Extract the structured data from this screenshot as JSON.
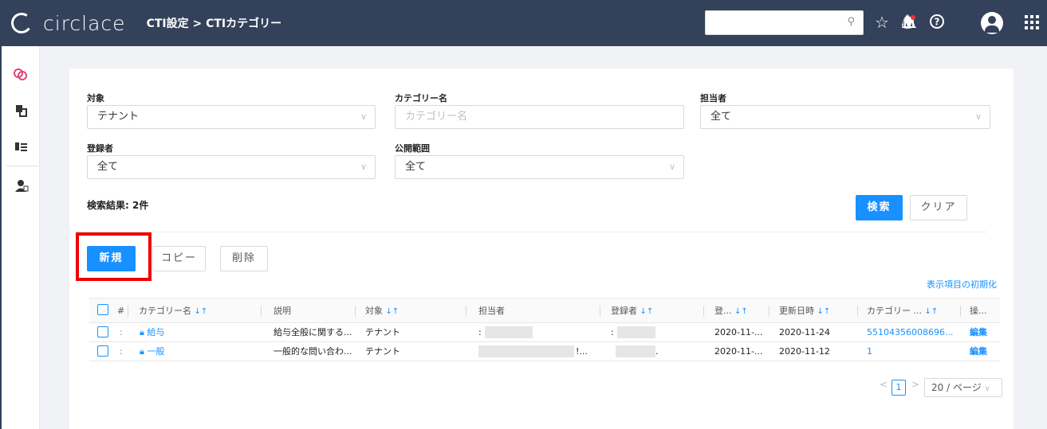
{
  "header": {
    "logo_text": "circlace",
    "breadcrumb": "CTI設定 > CTIカテゴリー",
    "search_placeholder": "",
    "icons": [
      "search-icon",
      "star-icon",
      "bell-icon",
      "help-icon",
      "avatar-icon",
      "apps-grid-icon"
    ],
    "bg_color": "#33425a"
  },
  "sidebar": {
    "icons": [
      "link-icon",
      "copy-icon",
      "list-icon",
      "agent-icon"
    ]
  },
  "filters": {
    "target_label": "対象",
    "target_value": "テナント",
    "category_name_label": "カテゴリー名",
    "category_name_placeholder": "カテゴリー名",
    "assignee_label": "担当者",
    "assignee_value": "全て",
    "registrant_label": "登録者",
    "registrant_value": "全て",
    "scope_label": "公開範囲",
    "scope_value": "全て"
  },
  "result_text": "検索結果: 2件",
  "buttons": {
    "search": "検索",
    "clear": "クリア",
    "new": "新規",
    "copy": "コピー",
    "delete": "削除"
  },
  "reset_columns_link": "表示項目の初期化",
  "table": {
    "headers": [
      "#",
      "カテゴリー名",
      "説明",
      "対象",
      "担当者",
      "登録者",
      "登...",
      "更新日時",
      "カテゴリー ...",
      "操..."
    ],
    "rows": [
      {
        "index": ":",
        "name": "給与",
        "description": "給与全般に関する...",
        "target": "テナント",
        "assignee": ":",
        "registrant": ":",
        "registered": "2020-11-...",
        "updated": "2020-11-24",
        "category_id": "55104356008696...",
        "action": "編集"
      },
      {
        "index": ":",
        "name": "一般",
        "description": "一般的な問い合わ...",
        "target": "テナント",
        "assignee": "!...",
        "registrant": ".",
        "registered": "2020-11-...",
        "updated": "2020-11-12",
        "category_id": "1",
        "action": "編集"
      }
    ]
  },
  "pagination": {
    "prev": "<",
    "current": "1",
    "next": ">",
    "page_size": "20 / ページ"
  },
  "colors": {
    "accent": "#1890ff",
    "highlight": "#ee0000"
  }
}
